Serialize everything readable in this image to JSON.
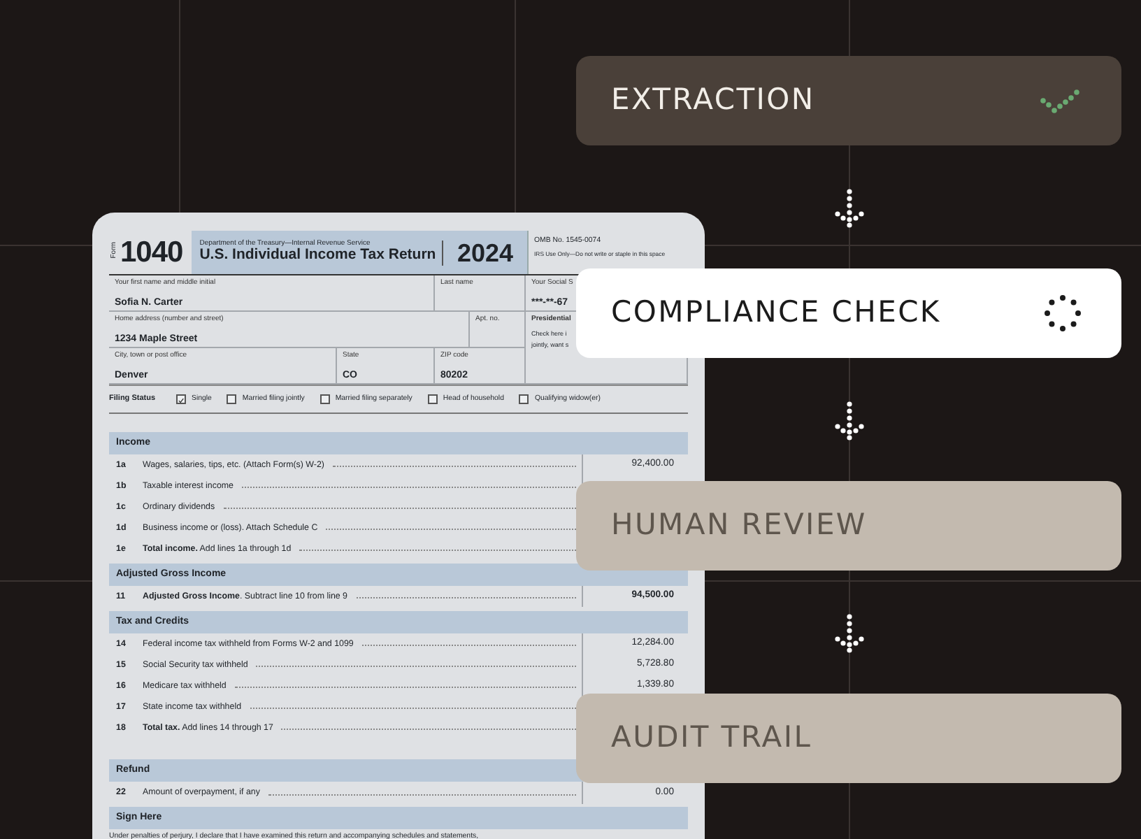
{
  "form": {
    "form_word": "Form",
    "number": "1040",
    "agency": "Department of the Treasury—Internal Revenue Service",
    "title": "U.S. Individual Income Tax Return",
    "year": "2024",
    "omb": "OMB No. 1545-0074",
    "irs_note": "IRS Use Only—Do not write or staple in this space",
    "fields": [
      {
        "label": "Your first name and middle initial",
        "value": "Sofia N. Carter"
      },
      {
        "label": "Last name"
      },
      {
        "label": "Your Social S",
        "value": "***-**-67"
      },
      {
        "label": "Home address (number and street)",
        "value": "1234 Maple Street"
      },
      {
        "label": "Apt. no."
      },
      {
        "label": "Presidential",
        "bold_label": true,
        "lines": [
          "Check here i",
          "jointly, want s"
        ]
      },
      {
        "label": "City, town or post office",
        "value": "Denver"
      },
      {
        "label": "State",
        "value": "CO"
      },
      {
        "label": "ZIP code",
        "value": "80202"
      }
    ],
    "filing_status": {
      "label": "Filing Status",
      "options": [
        {
          "label": "Single",
          "checked": true
        },
        {
          "label": "Married filing jointly",
          "checked": false
        },
        {
          "label": "Married filing separately",
          "checked": false
        },
        {
          "label": "Head of household",
          "checked": false
        },
        {
          "label": "Qualifying widow(er)",
          "checked": false
        }
      ]
    },
    "sections": [
      {
        "title": "Income",
        "lines": [
          {
            "number": "1a",
            "text": "Wages, salaries, tips, etc. (Attach Form(s) W-2)",
            "value": "92,400.00"
          },
          {
            "number": "1b",
            "text": "Taxable interest income"
          },
          {
            "number": "1c",
            "text": "Ordinary dividends"
          },
          {
            "number": "1d",
            "text": "Business income or (loss). Attach Schedule C"
          },
          {
            "number": "1e",
            "text": "**Total income.** Add lines 1a through 1d"
          }
        ]
      },
      {
        "title": "Adjusted Gross Income",
        "lines": [
          {
            "number": "11",
            "text": "**Adjusted Gross Income**. Subtract line 10 from line 9",
            "value": "94,500.00",
            "bold_value": true
          }
        ]
      },
      {
        "title": "Tax and Credits",
        "lines": [
          {
            "number": "14",
            "text": "Federal income tax withheld from Forms W-2 and 1099",
            "value": "12,284.00"
          },
          {
            "number": "15",
            "text": "Social Security tax withheld",
            "value": "5,728.80"
          },
          {
            "number": "16",
            "text": "Medicare tax withheld",
            "value": "1,339.80"
          },
          {
            "number": "17",
            "text": "State income tax withheld"
          },
          {
            "number": "18",
            "text": "**Total tax.** Add lines 14 through 17"
          }
        ]
      },
      {
        "title": "Refund",
        "lines": [
          {
            "number": "22",
            "text": "Amount of overpayment, if any",
            "value": "0.00"
          }
        ]
      },
      {
        "title": "Sign Here"
      }
    ],
    "sign_text": "Under penalties of perjury, I declare that I have examined this return and accompanying schedules and statements,"
  },
  "steps": [
    {
      "label": "EXTRACTION",
      "kind": "done"
    },
    {
      "label": "COMPLIANCE CHECK",
      "kind": "active"
    },
    {
      "label": "HUMAN REVIEW",
      "kind": "pending"
    },
    {
      "label": "AUDIT TRAIL",
      "kind": "pending"
    }
  ]
}
